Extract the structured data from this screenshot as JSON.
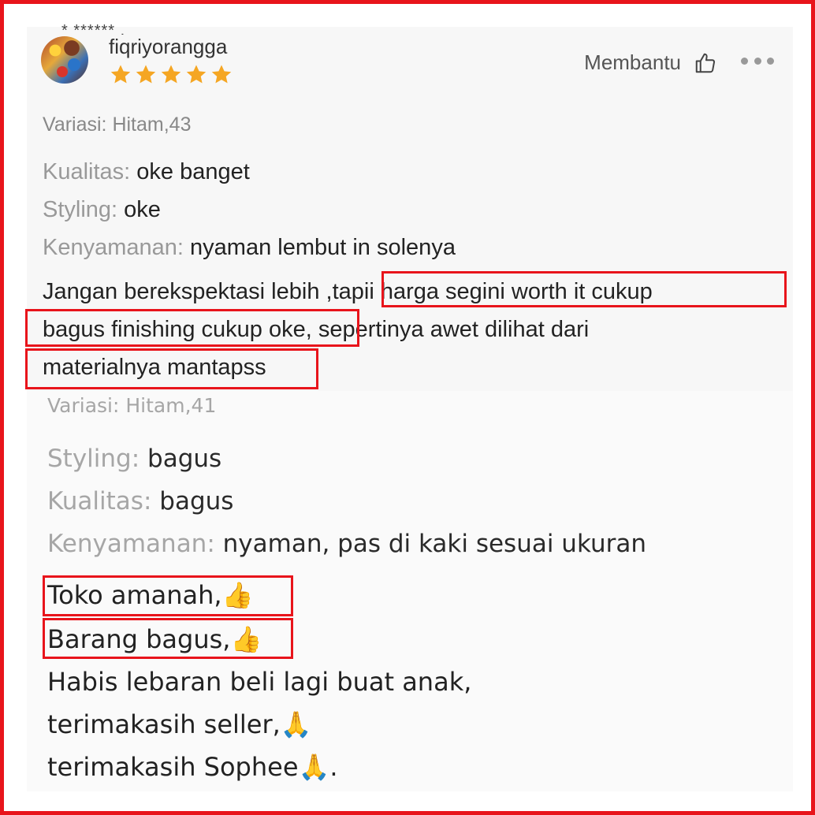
{
  "colors": {
    "highlight": "#e8141b",
    "star": "#f5a623"
  },
  "review1": {
    "peek_text": "* ****** .",
    "username": "fiqriyorangga",
    "rating": 5,
    "helpful_label": "Membantu",
    "variation": "Variasi: Hitam,43",
    "attributes": [
      {
        "label": "Kualitas:",
        "value": "oke banget"
      },
      {
        "label": "Styling:",
        "value": "oke"
      },
      {
        "label": "Kenyamanan:",
        "value": "nyaman lembut in solenya"
      }
    ],
    "body_lines": [
      "Jangan berekspektasi lebih ,tapii harga segini worth it cukup",
      "bagus finishing cukup oke, sepertinya awet dilihat dari",
      "materialnya mantapss"
    ]
  },
  "review2": {
    "variation": "Variasi: Hitam,41",
    "attributes": [
      {
        "label": "Styling:",
        "value": "bagus"
      },
      {
        "label": "Kualitas:",
        "value": "bagus"
      },
      {
        "label": "Kenyamanan:",
        "value": "nyaman, pas di kaki sesuai ukuran"
      }
    ],
    "body_lines": [
      "Toko amanah,👍",
      "Barang bagus,👍",
      "Habis lebaran beli lagi buat anak,",
      "terimakasih seller,🙏",
      "terimakasih Sophee🙏."
    ]
  }
}
